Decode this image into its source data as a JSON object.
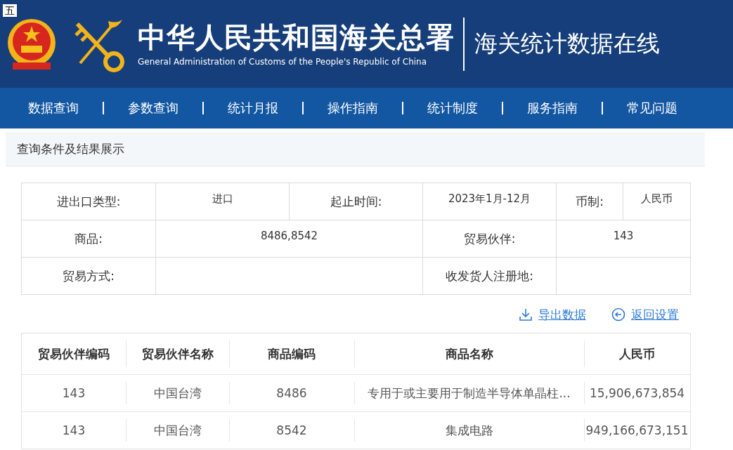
{
  "corner_mark": "五",
  "header": {
    "title_cn": "中华人民共和国海关总署",
    "title_en": "General Administration of Customs of the People's Republic of China",
    "site_title": "海关统计数据在线"
  },
  "nav": [
    "数据查询",
    "参数查询",
    "统计月报",
    "操作指南",
    "统计制度",
    "服务指南",
    "常见问题"
  ],
  "section_title": "查询条件及结果展示",
  "conditions": [
    [
      {
        "label": "进出口类型:",
        "value": "进口"
      },
      {
        "label": "起止时间:",
        "value": "2023年1月-12月"
      },
      {
        "label": "币制:",
        "value": "人民币"
      }
    ],
    [
      {
        "label": "商品:",
        "value": "8486,8542"
      },
      {
        "label": "贸易伙伴:",
        "value": "143"
      }
    ],
    [
      {
        "label": "贸易方式:"
      },
      {
        "label": "收发货人注册地:"
      }
    ]
  ],
  "actions": [
    {
      "kind": "export",
      "label": "导出数据"
    },
    {
      "kind": "back",
      "label": "返回设置"
    }
  ],
  "table": {
    "columns": [
      "贸易伙伴编码",
      "贸易伙伴名称",
      "商品编码",
      "商品名称",
      "人民币"
    ],
    "rows": [
      [
        "143",
        "中国台湾",
        "8486",
        "专用于或主要用于制造半导体单晶柱...",
        "15,906,673,854"
      ],
      [
        "143",
        "中国台湾",
        "8542",
        "集成电路",
        "949,166,673,151"
      ]
    ]
  }
}
